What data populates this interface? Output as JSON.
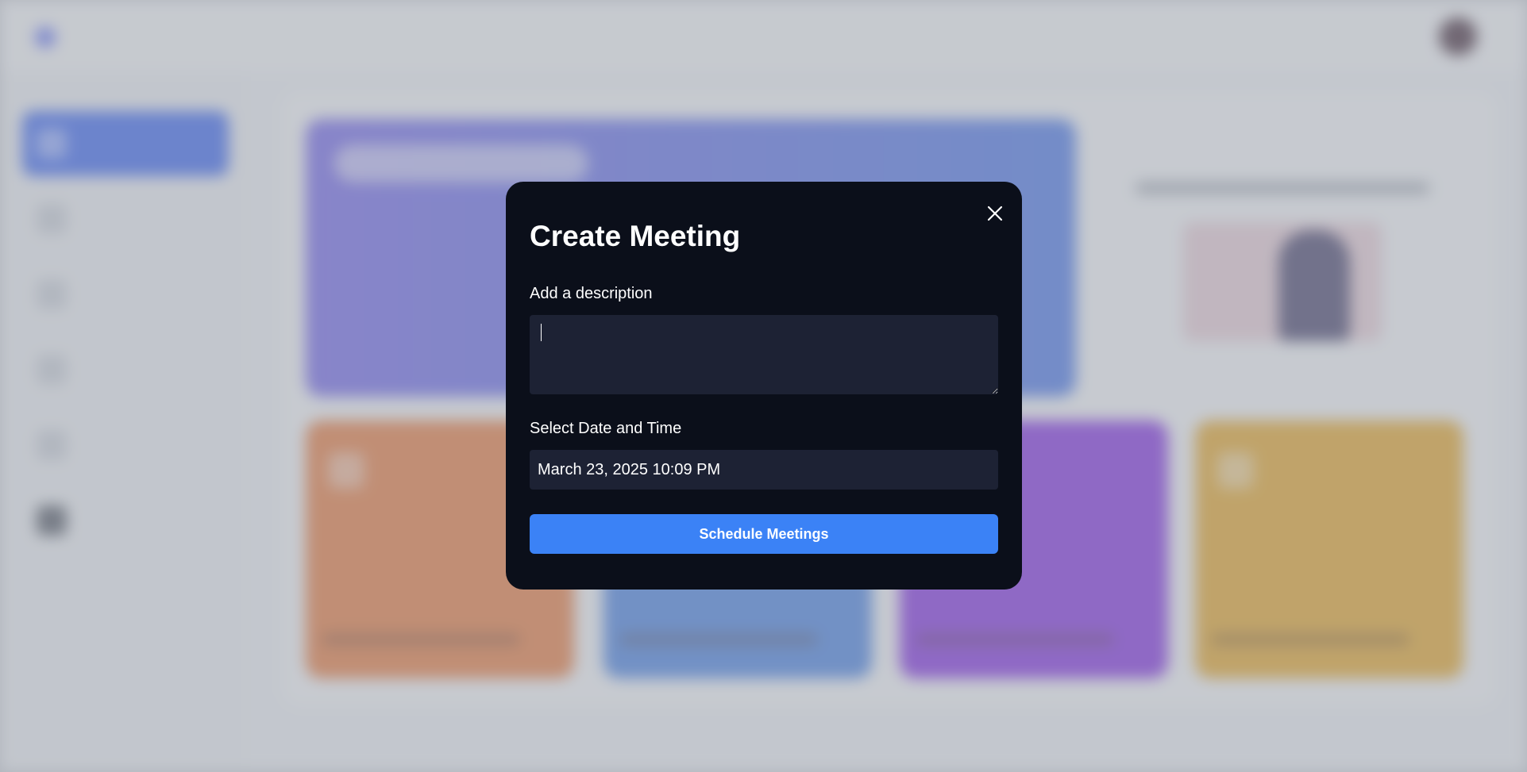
{
  "modal": {
    "title": "Create Meeting",
    "description_label": "Add a description",
    "description_value": "",
    "datetime_label": "Select Date and Time",
    "datetime_value": "March 23, 2025 10:09 PM",
    "submit_label": "Schedule Meetings",
    "close_icon": "close-icon"
  },
  "colors": {
    "modal_background": "#0b0f1a",
    "input_background": "#1d2234",
    "primary_button": "#3b82f6",
    "hero_gradient_start": "#6b5ce8",
    "hero_gradient_end": "#3d6ee6",
    "card_new_meeting": "#e8722f",
    "card_join_meeting": "#3b78e0",
    "card_schedule_meeting": "#7a1fe0",
    "card_view_recordings": "#e6a117"
  }
}
